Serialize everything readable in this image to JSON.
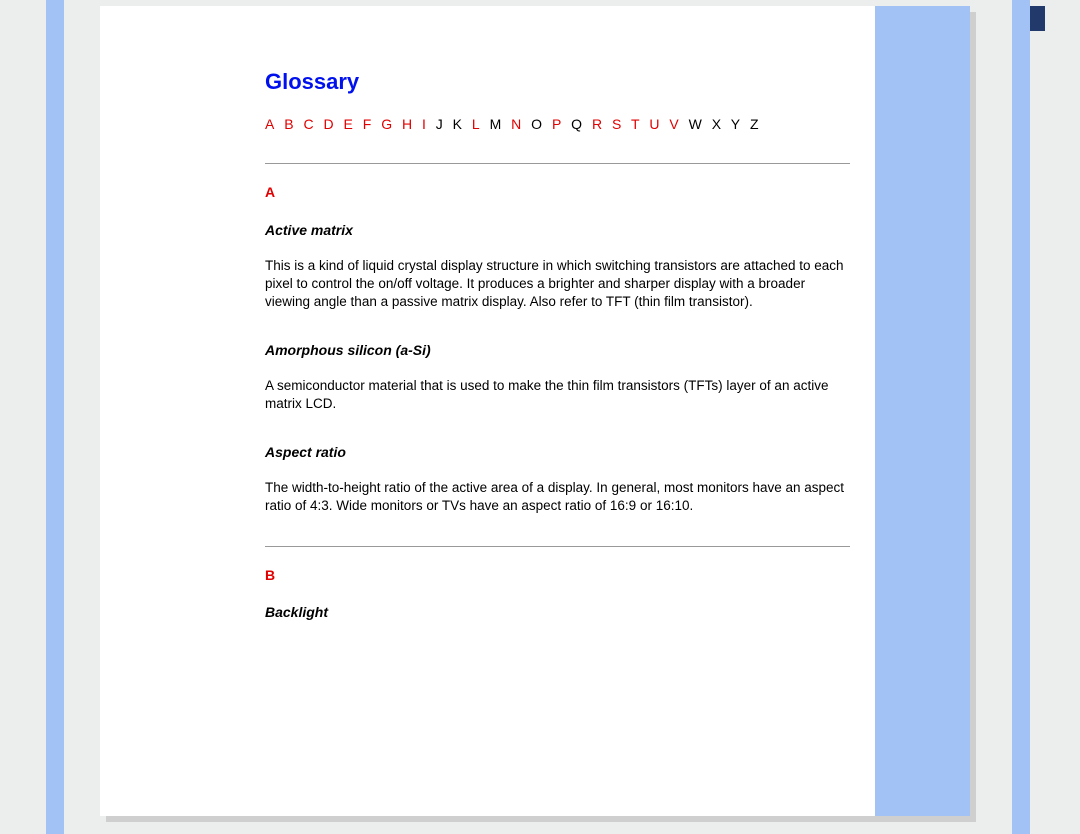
{
  "title": "Glossary",
  "alphabet": [
    {
      "label": "A",
      "link": true
    },
    {
      "label": "B",
      "link": true
    },
    {
      "label": "C",
      "link": true
    },
    {
      "label": "D",
      "link": true
    },
    {
      "label": "E",
      "link": true
    },
    {
      "label": "F",
      "link": true
    },
    {
      "label": "G",
      "link": true
    },
    {
      "label": "H",
      "link": true
    },
    {
      "label": "I",
      "link": true
    },
    {
      "label": "J",
      "link": false
    },
    {
      "label": "K",
      "link": false
    },
    {
      "label": "L",
      "link": true
    },
    {
      "label": "M",
      "link": false
    },
    {
      "label": "N",
      "link": true
    },
    {
      "label": "O",
      "link": false
    },
    {
      "label": "P",
      "link": true
    },
    {
      "label": "Q",
      "link": false
    },
    {
      "label": "R",
      "link": true
    },
    {
      "label": "S",
      "link": true
    },
    {
      "label": "T",
      "link": true
    },
    {
      "label": "U",
      "link": true
    },
    {
      "label": "V",
      "link": true
    },
    {
      "label": "W",
      "link": false
    },
    {
      "label": "X",
      "link": false
    },
    {
      "label": "Y",
      "link": false
    },
    {
      "label": "Z",
      "link": false
    }
  ],
  "sections": {
    "A": {
      "heading": "A",
      "entries": [
        {
          "term": "Active matrix",
          "def": "This is a kind of liquid crystal display structure in which switching transistors are attached to each pixel to control the on/off voltage. It produces a brighter and sharper display with a broader viewing angle than a passive matrix display. Also refer to TFT (thin film transistor)."
        },
        {
          "term": "Amorphous silicon (a-Si)",
          "def": "A semiconductor material that is used to make the thin film transistors (TFTs) layer of an active matrix LCD."
        },
        {
          "term": "Aspect ratio",
          "def": "The width-to-height ratio of the active area of a display. In general, most monitors have an aspect ratio of 4:3. Wide monitors or TVs have an aspect ratio of 16:9 or 16:10."
        }
      ]
    },
    "B": {
      "heading": "B",
      "entries": [
        {
          "term": "Backlight",
          "def": ""
        }
      ]
    }
  }
}
